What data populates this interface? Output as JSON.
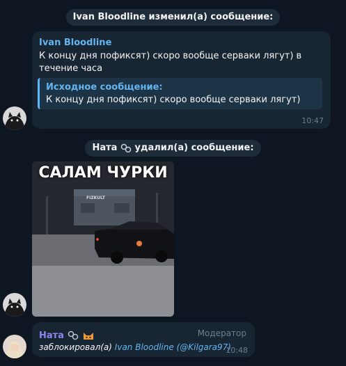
{
  "service1": {
    "text": "Ivan Bloodline изменил(а) сообщение:"
  },
  "msg1": {
    "author": "Ivan Bloodline",
    "text": "К концу дня пофиксят) скоро вообще серваки лягут) в течение часа",
    "quote_title": "Исходное сообщение:",
    "quote_text": "К концу дня пофиксят) скоро вообще серваки лягут)",
    "time": "10:47"
  },
  "service2": {
    "name": "Ната",
    "action": "удалил(а) сообщение:"
  },
  "media": {
    "caption": "САЛАМ ЧУРКИ",
    "sign": "FIZKULT"
  },
  "msg2": {
    "author": "Ната",
    "role": "Модератор",
    "action": "заблокировал(а)",
    "target_name": "Ivan Bloodline",
    "target_handle": "(@Kilgara97)",
    "time": "10:48"
  },
  "colors": {
    "background": "#0e1621",
    "bubble": "#182533",
    "accent": "#64b5ef",
    "author2": "#8e85ee"
  }
}
